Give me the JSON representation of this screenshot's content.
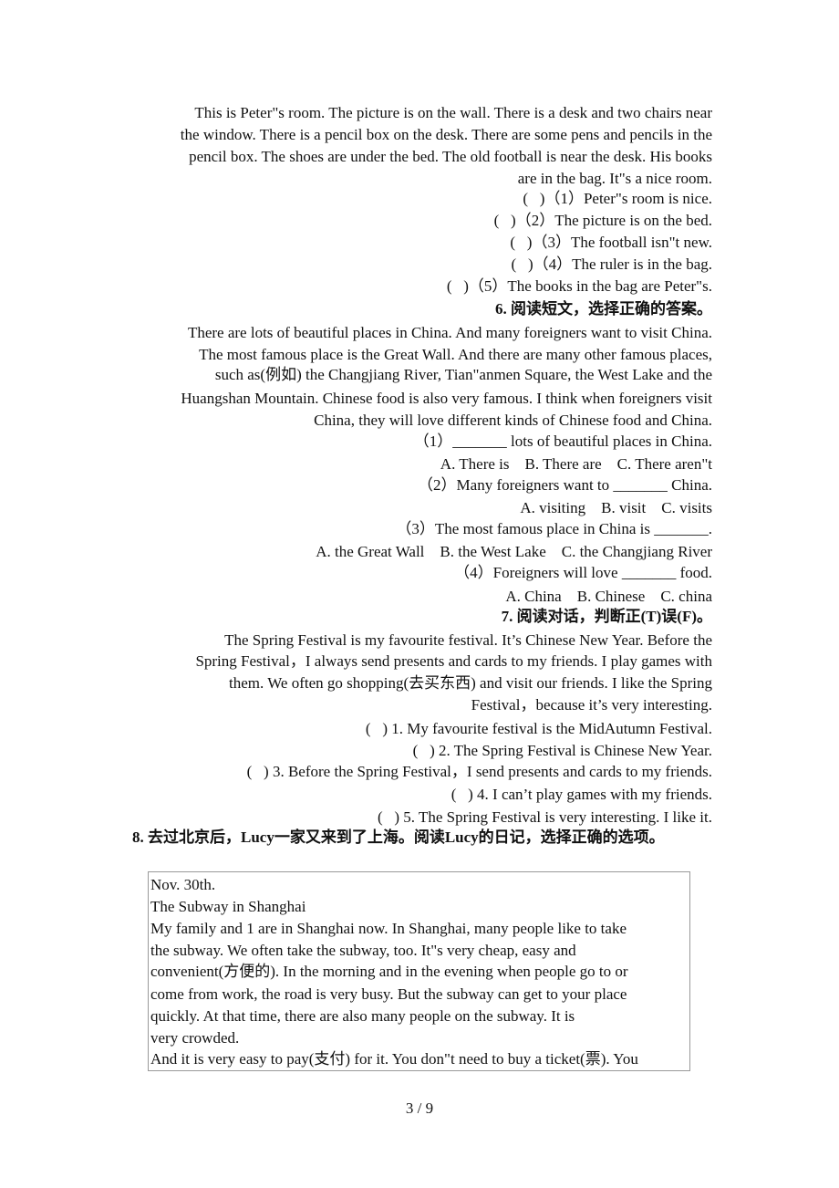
{
  "section5": {
    "passage": [
      "This is Peter\"s room. The picture is on the wall. There is a desk and two chairs near",
      "the window. There is a pencil box on the desk. There are some pens and pencils in the",
      "pencil box. The shoes are under the bed. The old football is near the desk. His books",
      "are in the bag. It\"s a nice room."
    ],
    "questions": [
      "(   )（1）Peter\"s room is nice.",
      "(   )（2）The picture is on the bed.",
      "(   )（3）The football isn\"t new.",
      "(   )（4）The ruler is in the bag.",
      "(   )（5）The books in the bag are Peter\"s."
    ]
  },
  "section6": {
    "heading": "6. 阅读短文，选择正确的答案。",
    "passage": [
      "There are lots of beautiful places in China. And many foreigners want to visit China.",
      "The most famous place is the Great Wall. And there are many other famous places,",
      "such as(例如) the Changjiang River, Tian\"anmen Square, the West Lake and the",
      "Huangshan Mountain. Chinese food is also very famous. I think when foreigners visit",
      "China, they will love different kinds of Chinese food and China."
    ],
    "questions": [
      "（1）_______ lots of beautiful places in China.",
      "A. There is    B. There are    C. There aren\"t",
      "（2）Many foreigners want to _______ China.",
      "A. visiting    B. visit    C. visits",
      "（3）The most famous place in China is _______.",
      "A. the Great Wall    B. the West Lake    C. the Changjiang River",
      "（4）Foreigners will love _______ food.",
      "A. China    B. Chinese    C. china"
    ]
  },
  "section7": {
    "heading": "7. 阅读对话，判断正(T)误(F)。",
    "passage": [
      "The Spring Festival is my favourite festival. It’s Chinese New Year. Before the",
      "Spring Festival，I always send presents and cards to my friends. I play games with",
      "them. We often go shopping(去买东西) and visit our friends. I like the Spring",
      "Festival，because it’s very interesting."
    ],
    "questions": [
      "(   ) 1. My favourite festival is the MidAutumn Festival.",
      "(   ) 2. The Spring Festival is Chinese New Year.",
      "(   ) 3. Before the Spring Festival，I send presents and cards to my friends.",
      "(   ) 4. I can’t play games with my friends.",
      "(   ) 5. The Spring Festival is very interesting. I like it."
    ]
  },
  "section8": {
    "heading": "8. 去过北京后，Lucy一家又来到了上海。阅读Lucy的日记，选择正确的选项。",
    "diary": [
      "Nov. 30th.",
      "The Subway in Shanghai",
      "My family and 1 are in Shanghai now. In Shanghai, many people like to take",
      "the subway. We often take the subway, too. It\"s very cheap, easy and",
      "convenient(方便的). In the morning and in the evening when people go to or",
      "come from work, the road is very busy. But the subway can get to your place",
      "quickly. At that time, there are also many people on the subway. It is",
      "very crowded.",
      "And it is very easy to pay(支付) for it. You don\"t need to buy a ticket(票). You"
    ]
  },
  "footer": {
    "page_number": "3 / 9"
  }
}
